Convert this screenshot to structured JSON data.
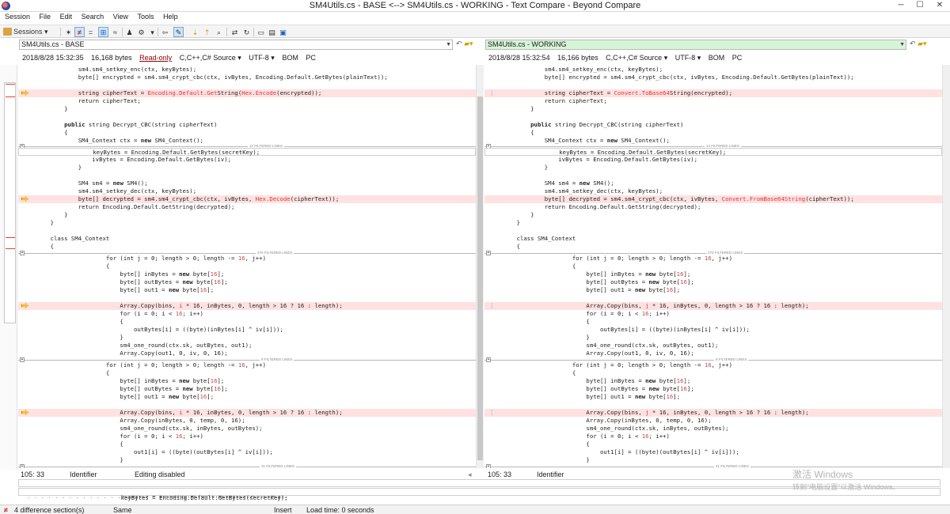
{
  "window": {
    "title": "SM4Utils.cs - BASE <--> SM4Utils.cs - WORKING - Text Compare - Beyond Compare",
    "min": "─",
    "max": "☐",
    "close": "✕"
  },
  "menu": [
    "Session",
    "File",
    "Edit",
    "Search",
    "View",
    "Tools",
    "Help"
  ],
  "toolbar": {
    "sessions": "Sessions ▾"
  },
  "left": {
    "path": "SM4Utils.cs - BASE",
    "date": "2018/8/28 15:32:35",
    "size": "16,168 bytes",
    "readonly": "Read-only",
    "format": "C,C++,C# Source ▾",
    "encoding": "UTF-8 ▾",
    "bom": "BOM",
    "eol": "PC",
    "status": {
      "pos": "105: 33",
      "token": "Identifier",
      "edit": "Editing disabled"
    }
  },
  "right": {
    "path": "SM4Utils.cs - WORKING",
    "date": "2018/8/28 15:32:54",
    "size": "16,166 bytes",
    "format": "C,C++,C# Source ▾",
    "encoding": "UTF-8 ▾",
    "bom": "BOM",
    "eol": "PC",
    "status": {
      "pos": "105: 33",
      "token": "Identifier"
    }
  },
  "filters": [
    "12 FILTERED LINES",
    "270 FILTERED LINES",
    "9 FILTERED LINES",
    "21 FILTERED LINES"
  ],
  "detail": {
    "row1": "keyBytes = Encoding.Default.GetBytes(secretKey);",
    "row2": "keyBytes = Encoding.Default.GetBytes(secretKey);"
  },
  "watermark": {
    "line1": "激活 Windows",
    "line2": "转到\"电脑设置\"以激活 Windows。"
  },
  "statusbar": {
    "diffs": "4 difference section(s)",
    "same": "Same",
    "insert": "Insert",
    "load": "Load time: 0 seconds"
  },
  "colors": {
    "diff_bg": "#ffe1e1",
    "diff_text": "#e83030",
    "right_header": "#d6f5d6"
  }
}
